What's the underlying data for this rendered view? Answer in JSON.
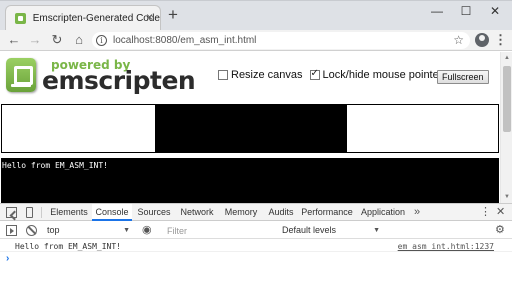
{
  "browser": {
    "tab_title": "Emscripten-Generated Code",
    "tab_close": "×",
    "new_tab": "+",
    "window_controls": {
      "minimize": "—",
      "maximize": "☐",
      "close": "✕"
    },
    "nav": {
      "back": "←",
      "forward": "→",
      "reload": "↻",
      "home": "⌂"
    },
    "address": "localhost:8080/em_asm_int.html",
    "star": "☆",
    "menu": "⋮"
  },
  "page": {
    "logo": {
      "powered_by": "powered by",
      "name": "emscripten"
    },
    "controls": {
      "resize_canvas": {
        "label": "Resize canvas",
        "checked": false
      },
      "lock_pointer": {
        "label": "Lock/hide mouse pointer",
        "checked": true
      },
      "fullscreen_label": "Fullscreen"
    },
    "output_text": "Hello from EM_ASM_INT!"
  },
  "devtools": {
    "tabs": [
      {
        "label": "Elements",
        "active": false
      },
      {
        "label": "Console",
        "active": true
      },
      {
        "label": "Sources",
        "active": false
      },
      {
        "label": "Network",
        "active": false
      },
      {
        "label": "Memory",
        "active": false
      },
      {
        "label": "Audits",
        "active": false
      },
      {
        "label": "Performance",
        "active": false
      },
      {
        "label": "Application",
        "active": false
      }
    ],
    "more": "»",
    "menu": "⋮",
    "close": "✕",
    "context": "top",
    "filter_placeholder": "Filter",
    "levels": "Default levels",
    "messages": [
      {
        "text": "Hello from EM_ASM_INT!",
        "source": "em_asm_int.html:1237"
      }
    ],
    "prompt": "›"
  },
  "colors": {
    "accent": "#1a73e8",
    "logo_green": "#7ab648",
    "canvas_black": "#000000"
  }
}
